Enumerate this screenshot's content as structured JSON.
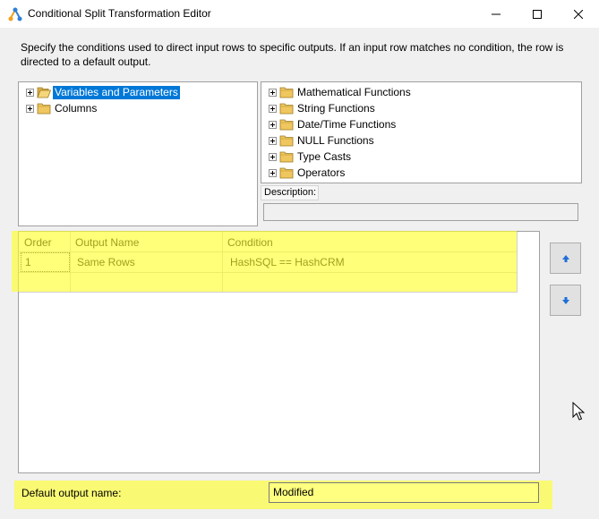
{
  "window": {
    "title": "Conditional Split Transformation Editor"
  },
  "instructions": "Specify the conditions used to direct input rows to specific outputs. If an input row matches no condition, the row is directed to a default output.",
  "left_tree": {
    "items": [
      {
        "label": "Variables and Parameters",
        "selected": true
      },
      {
        "label": "Columns",
        "selected": false
      }
    ]
  },
  "right_tree": {
    "items": [
      {
        "label": "Mathematical Functions"
      },
      {
        "label": "String Functions"
      },
      {
        "label": "Date/Time Functions"
      },
      {
        "label": "NULL Functions"
      },
      {
        "label": "Type Casts"
      },
      {
        "label": "Operators"
      }
    ]
  },
  "description": {
    "label": "Description:",
    "value": ""
  },
  "grid": {
    "columns": [
      "Order",
      "Output Name",
      "Condition"
    ],
    "rows": [
      {
        "order": "1",
        "output_name": "Same Rows",
        "condition": "HashSQL == HashCRM"
      }
    ]
  },
  "default_output": {
    "label": "Default output name:",
    "value": "Modified"
  },
  "colors": {
    "selection": "#0078d7",
    "highlight": "#ffff28",
    "arrow": "#1e6fd9"
  }
}
